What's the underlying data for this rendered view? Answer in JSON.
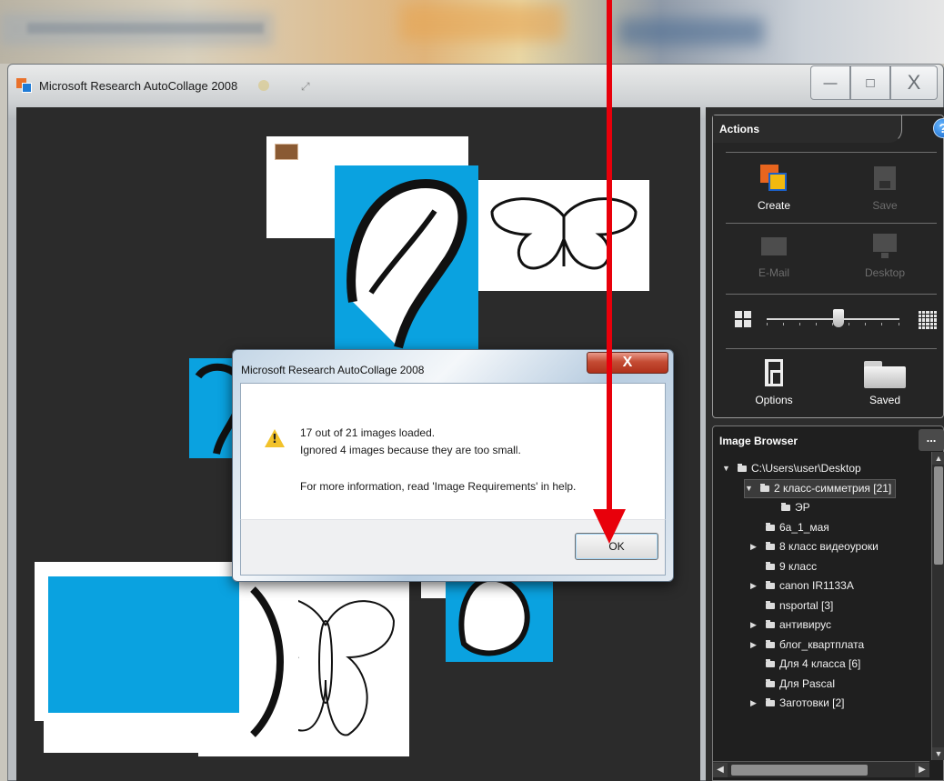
{
  "window": {
    "title": "Microsoft Research AutoCollage 2008",
    "controls": {
      "minimize": "—",
      "maximize": "□",
      "close": "X"
    }
  },
  "actions_panel": {
    "title": "Actions",
    "help": "?",
    "create_label": "Create",
    "save_label": "Save",
    "email_label": "E-Mail",
    "desktop_label": "Desktop",
    "options_label": "Options",
    "saved_label": "Saved"
  },
  "image_browser": {
    "title": "Image Browser",
    "more": "...",
    "items": [
      {
        "label": "C:\\Users\\user\\Desktop",
        "toggle": "▼"
      },
      {
        "label": "2 класс-симметрия  [21]",
        "toggle": "▼",
        "selected": true
      },
      {
        "label": "ЭР",
        "toggle": ""
      },
      {
        "label": "6а_1_мая",
        "toggle": ""
      },
      {
        "label": "8 класс видеоуроки",
        "toggle": "▶"
      },
      {
        "label": "9 класс",
        "toggle": ""
      },
      {
        "label": "canon IR1133A",
        "toggle": "▶"
      },
      {
        "label": "nsportal  [3]",
        "toggle": ""
      },
      {
        "label": "антивирус",
        "toggle": "▶"
      },
      {
        "label": "блог_квартплата",
        "toggle": "▶"
      },
      {
        "label": "Для 4 класса  [6]",
        "toggle": ""
      },
      {
        "label": "Для Pascal",
        "toggle": ""
      },
      {
        "label": "Заготовки  [2]",
        "toggle": "▶"
      }
    ]
  },
  "dialog": {
    "title": "Microsoft Research AutoCollage 2008",
    "close": "X",
    "line1": "17 out of 21 images loaded.",
    "line2": "Ignored 4 images because they are too small.",
    "line3": "For more information, read 'Image Requirements' in help.",
    "ok_label": "OK"
  },
  "colors": {
    "annotation_arrow": "#e8000b",
    "collage_blue": "#0aa2e0",
    "canvas_bg": "#2b2b2b"
  }
}
